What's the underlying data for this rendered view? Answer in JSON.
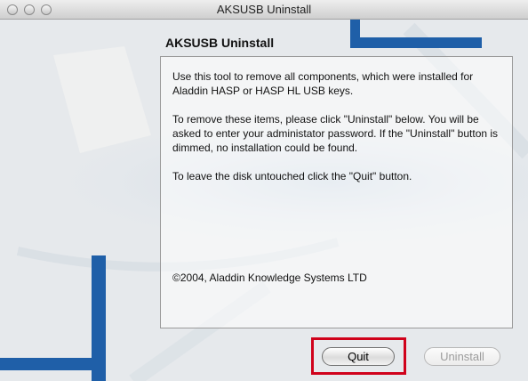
{
  "window": {
    "title": "AKSUSB Uninstall"
  },
  "panel": {
    "title": "AKSUSB Uninstall",
    "paragraphs": [
      "Use this tool to remove all components, which were installed for Aladdin HASP or HASP HL USB keys.",
      "To remove these items, please click \"Uninstall\" below. You will be asked to enter your administator password. If the \"Uninstall\" button is dimmed, no installation could be found.",
      "To leave the disk untouched click the \"Quit\" button.",
      "©2004, Aladdin Knowledge Systems LTD"
    ]
  },
  "buttons": {
    "quit_label": "Quit",
    "uninstall_label": "Uninstall",
    "uninstall_enabled": false
  },
  "annotation": {
    "highlight_color": "#d0021b",
    "highlighted": "quit-button"
  },
  "colors": {
    "accent_blue": "#1f5fa8"
  }
}
